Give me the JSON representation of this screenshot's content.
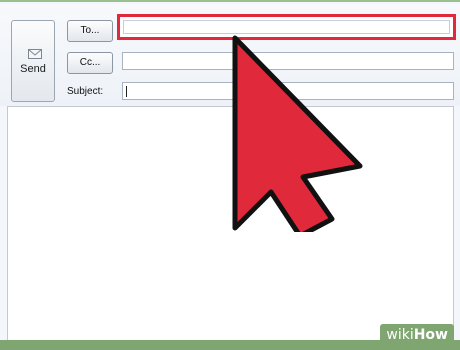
{
  "compose": {
    "send_label": "Send",
    "to_label": "To...",
    "cc_label": "Cc...",
    "subject_label": "Subject:",
    "to_value": "",
    "cc_value": "",
    "subject_value": ""
  },
  "watermark": {
    "part1": "wiki",
    "part2": "How"
  },
  "colors": {
    "highlight": "#e0293a",
    "cursor": "#e0293a",
    "brand_green": "#7fa571"
  },
  "icons": {
    "send": "envelope-icon",
    "pointer": "arrow-cursor-icon"
  }
}
